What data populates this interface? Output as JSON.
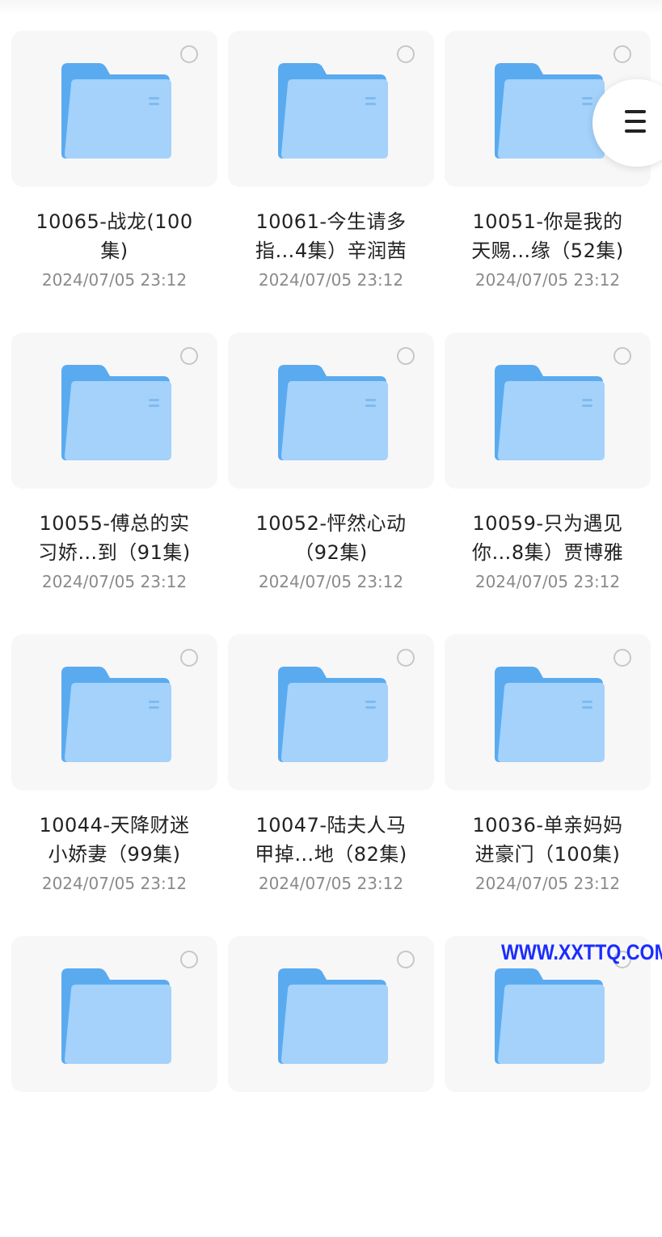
{
  "files": [
    {
      "title_line1": "10065-战龙(100",
      "title_line2": "集)",
      "date": "2024/07/05 23:12"
    },
    {
      "title_line1": "10061-今生请多",
      "title_line2": "指…4集）辛润茜",
      "date": "2024/07/05 23:12"
    },
    {
      "title_line1": "10051-你是我的",
      "title_line2": "天赐…缘（52集)",
      "date": "2024/07/05 23:12"
    },
    {
      "title_line1": "10055-傅总的实",
      "title_line2": "习娇…到（91集)",
      "date": "2024/07/05 23:12"
    },
    {
      "title_line1": "10052-怦然心动",
      "title_line2": "（92集)",
      "date": "2024/07/05 23:12"
    },
    {
      "title_line1": "10059-只为遇见",
      "title_line2": "你…8集）贾博雅",
      "date": "2024/07/05 23:12"
    },
    {
      "title_line1": "10044-天降财迷",
      "title_line2": "小娇妻（99集)",
      "date": "2024/07/05 23:12"
    },
    {
      "title_line1": "10047-陆夫人马",
      "title_line2": "甲掉…地（82集)",
      "date": "2024/07/05 23:12"
    },
    {
      "title_line1": "10036-单亲妈妈",
      "title_line2": "进豪门（100集)",
      "date": "2024/07/05 23:12"
    },
    {
      "title_line1": "",
      "title_line2": "",
      "date": ""
    },
    {
      "title_line1": "",
      "title_line2": "",
      "date": ""
    },
    {
      "title_line1": "",
      "title_line2": "",
      "date": ""
    }
  ],
  "icons": {
    "folder": "folder-icon",
    "select": "select-circle-icon",
    "menu": "hamburger-menu-icon"
  },
  "colors": {
    "folder_back": "#5aaaf0",
    "folder_front": "#a4d2fb",
    "thumb_bg": "#f7f7f7",
    "date_text": "#8a8a8a",
    "watermark": "#1a2cff"
  },
  "watermark": "WWW.XXTTQ.COM"
}
